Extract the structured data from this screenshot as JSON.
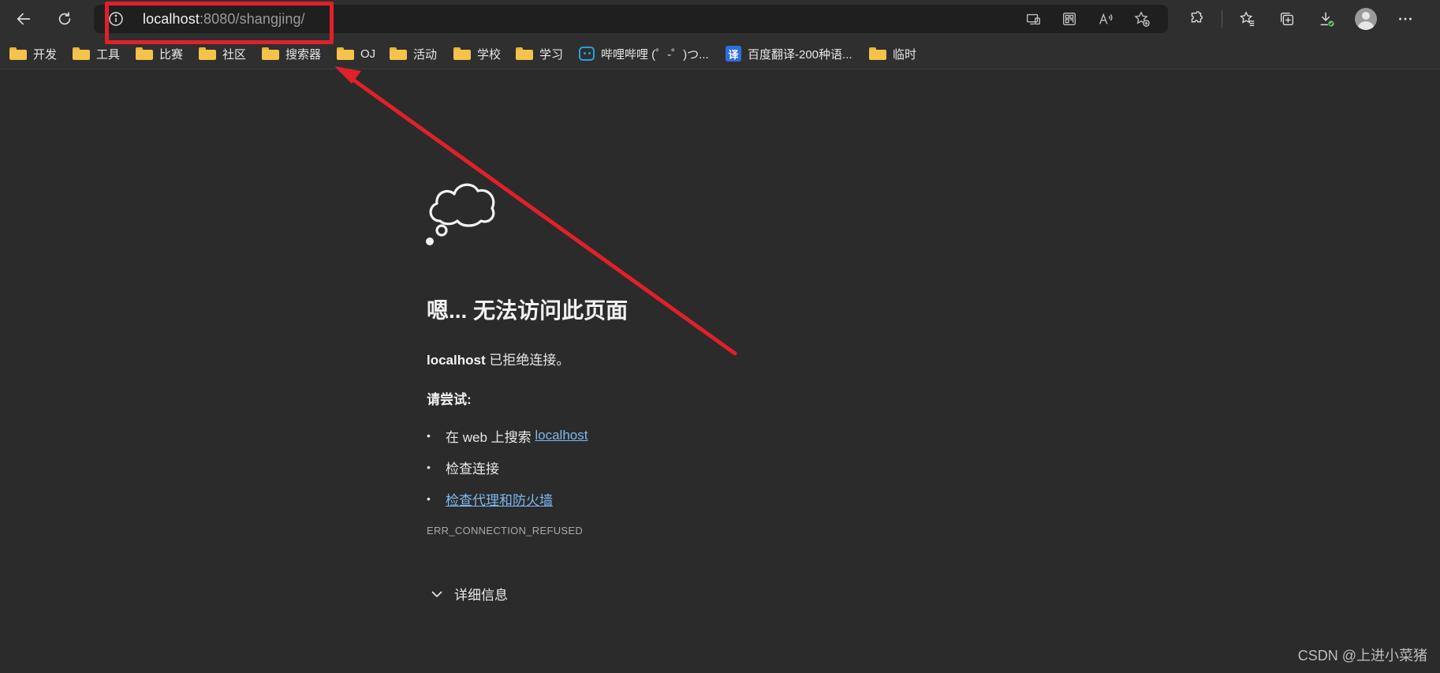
{
  "address_bar": {
    "url_host": "localhost",
    "url_path": ":8080/shangjing/"
  },
  "bookmarks": [
    {
      "label": "开发",
      "icon": "folder-icon"
    },
    {
      "label": "工具",
      "icon": "folder-icon"
    },
    {
      "label": "比赛",
      "icon": "folder-icon"
    },
    {
      "label": "社区",
      "icon": "folder-icon"
    },
    {
      "label": "搜索器",
      "icon": "folder-icon"
    },
    {
      "label": "OJ",
      "icon": "folder-icon"
    },
    {
      "label": "活动",
      "icon": "folder-icon"
    },
    {
      "label": "学校",
      "icon": "folder-icon"
    },
    {
      "label": "学习",
      "icon": "folder-icon"
    },
    {
      "label": "哔哩哔哩 (゜-゜)つ...",
      "icon": "bilibili-icon"
    },
    {
      "label": "百度翻译-200种语...",
      "icon": "translate-icon"
    },
    {
      "label": "临时",
      "icon": "folder-icon"
    }
  ],
  "error": {
    "title": "嗯... 无法访问此页面",
    "host": "localhost",
    "description": " 已拒绝连接。",
    "try_title": "请尝试:",
    "suggestion_1_prefix": "在 web 上搜索 ",
    "suggestion_1_link": "localhost",
    "suggestion_2": "检查连接",
    "suggestion_3_link": "检查代理和防火墙",
    "code": "ERR_CONNECTION_REFUSED",
    "details_label": "详细信息"
  },
  "watermark": "CSDN @上进小菜猪",
  "colors": {
    "annotation_red": "#e0202a",
    "link_blue": "#7db7f0",
    "background": "#2b2b2b"
  }
}
